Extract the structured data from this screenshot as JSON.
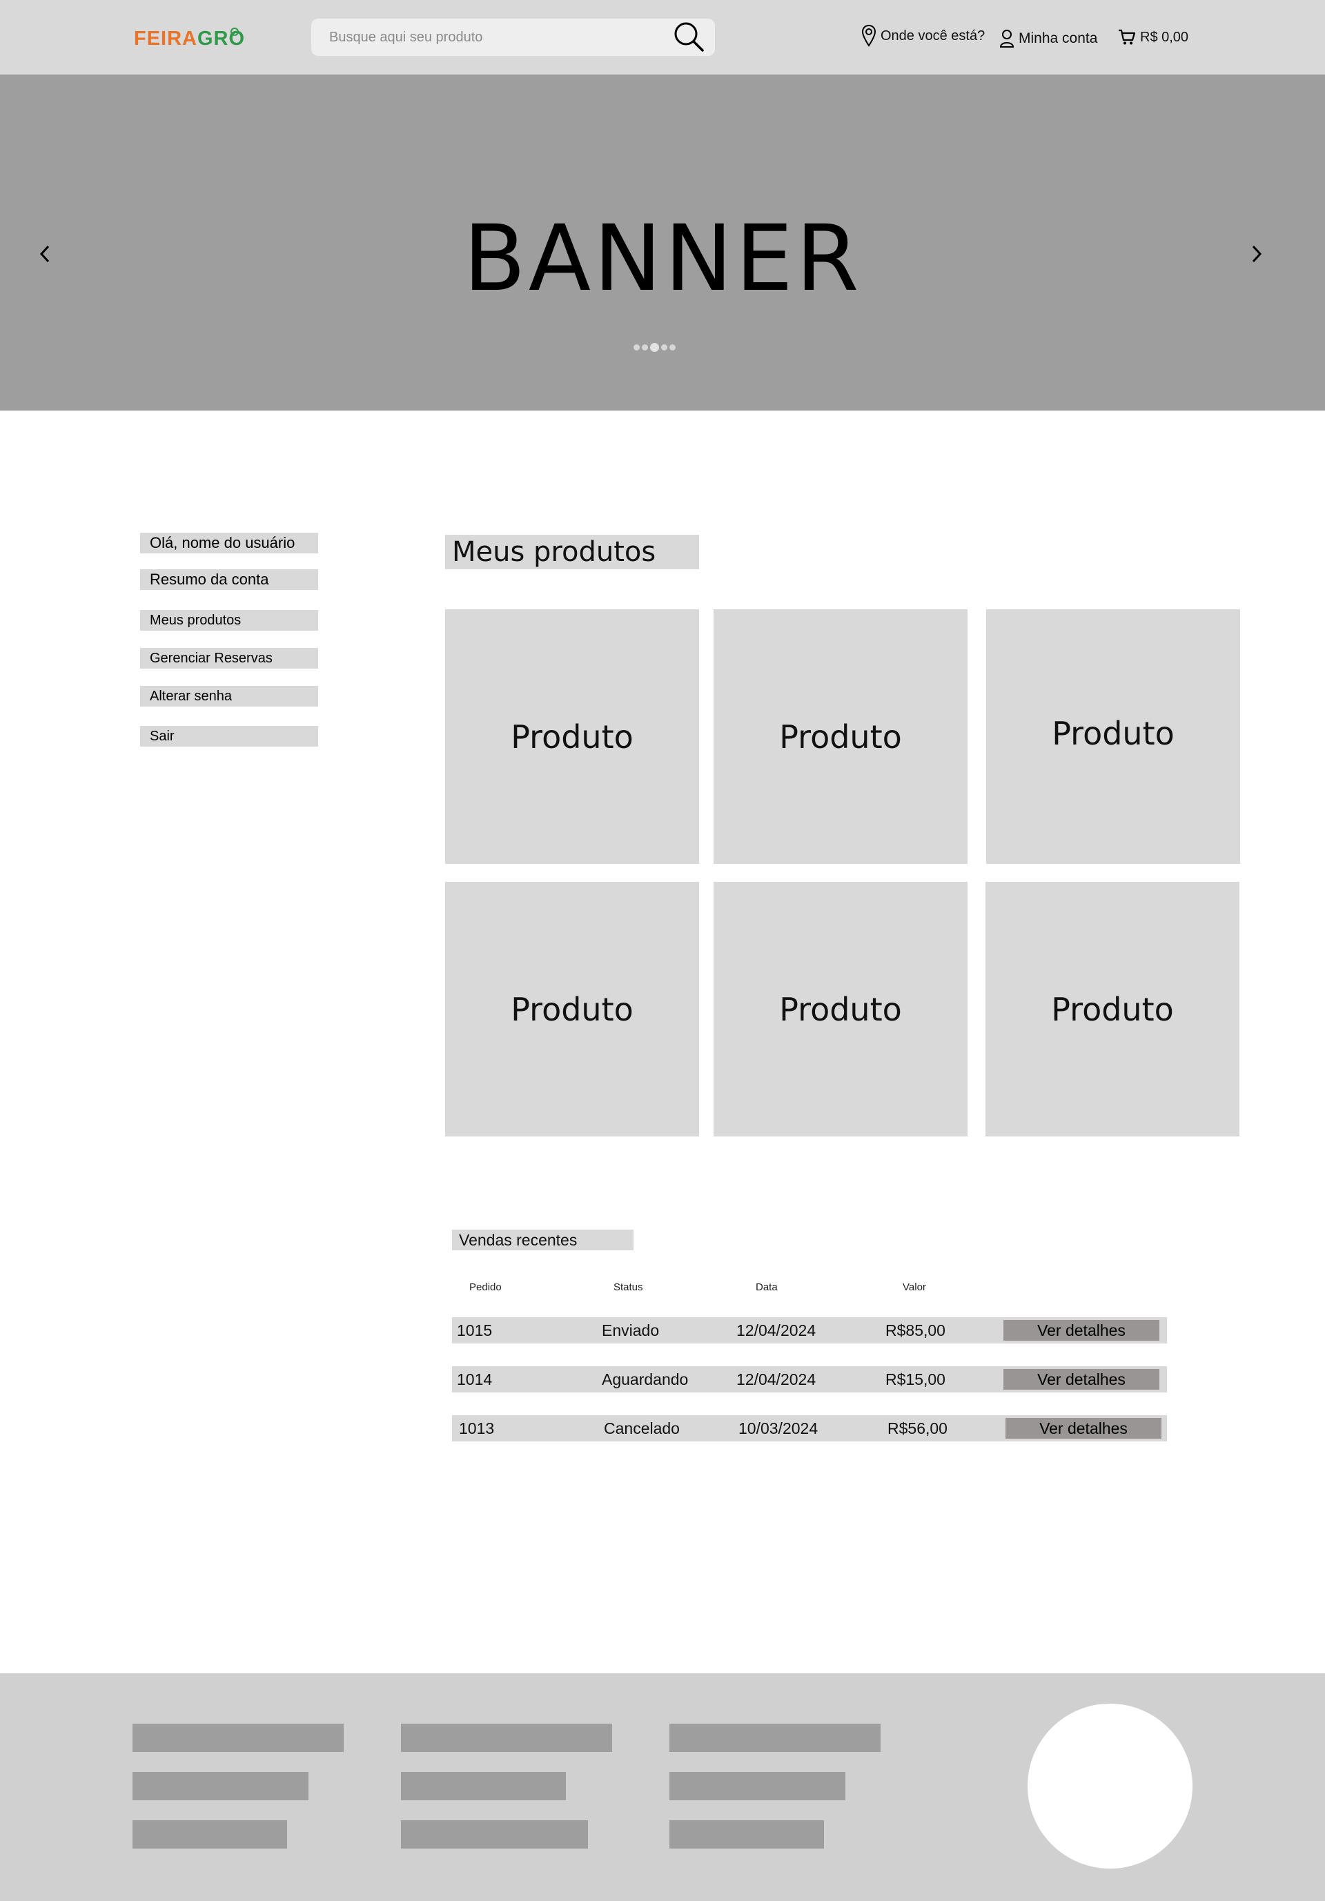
{
  "header": {
    "logo_part1": "FEIRA",
    "logo_part2": "GRO",
    "search_placeholder": "Busque aqui seu produto",
    "location_label": "Onde você está?",
    "account_label": "Minha conta",
    "cart_total": "R$ 0,00"
  },
  "banner": {
    "title": "BANNER",
    "dot_count": 5,
    "active_dot": 2
  },
  "sidebar": {
    "items": [
      {
        "label": "Olá, nome do usuário"
      },
      {
        "label": "Resumo da conta"
      },
      {
        "label": "Meus produtos"
      },
      {
        "label": "Gerenciar Reservas"
      },
      {
        "label": "Alterar senha"
      },
      {
        "label": "Sair"
      }
    ]
  },
  "main": {
    "title": "Meus produtos",
    "products": [
      {
        "label": "Produto"
      },
      {
        "label": "Produto"
      },
      {
        "label": "Produto"
      },
      {
        "label": "Produto"
      },
      {
        "label": "Produto"
      },
      {
        "label": "Produto"
      }
    ]
  },
  "sales": {
    "title": "Vendas recentes",
    "columns": [
      "Pedido",
      "Status",
      "Data",
      "Valor"
    ],
    "rows": [
      {
        "order": "1015",
        "status": "Enviado",
        "date": "12/04/2024",
        "value": "R$85,00",
        "action": "Ver detalhes"
      },
      {
        "order": "1014",
        "status": "Aguardando",
        "date": "12/04/2024",
        "value": "R$15,00",
        "action": "Ver detalhes"
      },
      {
        "order": "1013",
        "status": "Cancelado",
        "date": "10/03/2024",
        "value": "R$56,00",
        "action": "Ver detalhes"
      }
    ]
  },
  "colors": {
    "header_bg": "#d9d9d9",
    "banner_bg": "#9e9e9e",
    "logo_orange": "#e8742a",
    "logo_green": "#2e9a4a",
    "button_bg": "#9a9595",
    "footer_bg": "#d0d0d0"
  }
}
